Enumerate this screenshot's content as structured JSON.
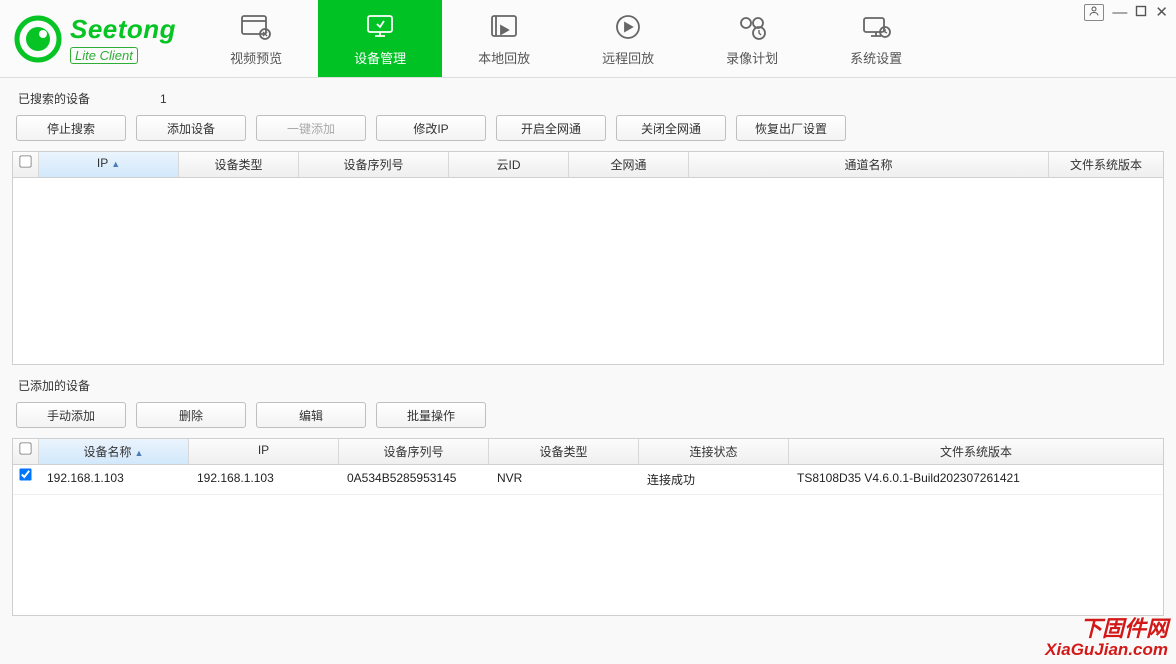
{
  "brand": {
    "name": "Seetong",
    "sub": "Lite Client"
  },
  "nav": [
    {
      "label": "视频预览"
    },
    {
      "label": "设备管理"
    },
    {
      "label": "本地回放"
    },
    {
      "label": "远程回放"
    },
    {
      "label": "录像计划"
    },
    {
      "label": "系统设置"
    }
  ],
  "nav_active_index": 1,
  "searched": {
    "title": "已搜索的设备",
    "count": "1",
    "buttons": {
      "stop_search": "停止搜索",
      "add_device": "添加设备",
      "one_click_add": "一键添加",
      "modify_ip": "修改IP",
      "open_all_net": "开启全网通",
      "close_all_net": "关闭全网通",
      "restore_factory": "恢复出厂设置"
    },
    "columns": [
      "IP",
      "设备类型",
      "设备序列号",
      "云ID",
      "全网通",
      "通道名称",
      "文件系统版本"
    ],
    "rows": []
  },
  "added": {
    "title": "已添加的设备",
    "buttons": {
      "manual_add": "手动添加",
      "delete": "删除",
      "edit": "编辑",
      "batch": "批量操作"
    },
    "columns": [
      "设备名称",
      "IP",
      "设备序列号",
      "设备类型",
      "连接状态",
      "文件系统版本"
    ],
    "rows": [
      {
        "checked": true,
        "name": "192.168.1.103",
        "ip": "192.168.1.103",
        "serial": "0A534B5285953145",
        "type": "NVR",
        "status": "连接成功",
        "firmware": "TS8108D35 V4.6.0.1-Build202307261421"
      }
    ]
  },
  "watermark": {
    "cn": "下固件网",
    "en": "XiaGuJian.com"
  }
}
